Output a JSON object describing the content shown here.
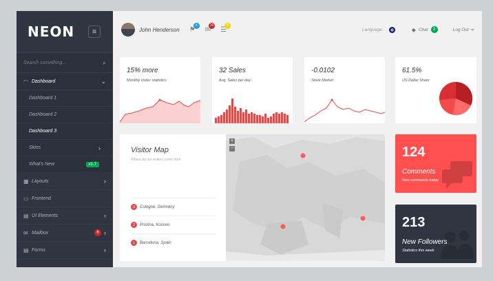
{
  "sidebar": {
    "logo": "NEON",
    "menu_icon": "hamburger-icon",
    "search_placeholder": "Search something...",
    "items": [
      {
        "label": "Dashboard",
        "icon": "gauge-icon"
      },
      {
        "label": "Dashboard 1"
      },
      {
        "label": "Dashboard 2"
      },
      {
        "label": "Dashboard 3"
      },
      {
        "label": "Skins"
      },
      {
        "label": "What's New",
        "badge": "v1.7"
      },
      {
        "label": "Layouts",
        "icon": "grid-icon"
      },
      {
        "label": "Frontend",
        "icon": "monitor-icon"
      },
      {
        "label": "UI Elements",
        "icon": "document-icon"
      },
      {
        "label": "Mailbox",
        "icon": "mail-icon",
        "badge": "8"
      },
      {
        "label": "Forms",
        "icon": "form-icon"
      }
    ]
  },
  "header": {
    "user_name": "John Henderson",
    "notifications": [
      {
        "icon": "flag-icon",
        "badge": "4",
        "color": "#1f9bde"
      },
      {
        "icon": "envelope-icon",
        "badge": "10",
        "color": "#cc2424"
      },
      {
        "icon": "list-icon",
        "badge": "9",
        "color": "#f5d214"
      }
    ],
    "language_label": "Language:",
    "chat_label": "Chat",
    "chat_badge": "3",
    "logout_label": "Log Out"
  },
  "tiles": [
    {
      "value": "15% more",
      "caption": "Monthly visitor statistics"
    },
    {
      "value": "32 Sales",
      "caption": "Avg. Sales per day"
    },
    {
      "value": "-0.0102",
      "caption": "Stock Market"
    },
    {
      "value": "61.5%",
      "caption": "US Dollar Share"
    }
  ],
  "map_panel": {
    "title": "Visitor Map",
    "subtitle": "Where do our visitors come from",
    "zoom_in": "+",
    "zoom_out": "−",
    "locations": [
      {
        "num": "3",
        "name": "Cologne, Germany"
      },
      {
        "num": "2",
        "name": "Pristina, Kosovo"
      },
      {
        "num": "1",
        "name": "Barcelona, Spain"
      }
    ]
  },
  "comments": {
    "value": "124",
    "title": "Comments",
    "subtitle": "New comments today"
  },
  "followers": {
    "value": "213",
    "title": "New Followers",
    "subtitle": "Statistics this week"
  },
  "colors": {
    "accent": "#ff4f4f",
    "sidebar": "#303641",
    "dark_tile": "#303641"
  }
}
